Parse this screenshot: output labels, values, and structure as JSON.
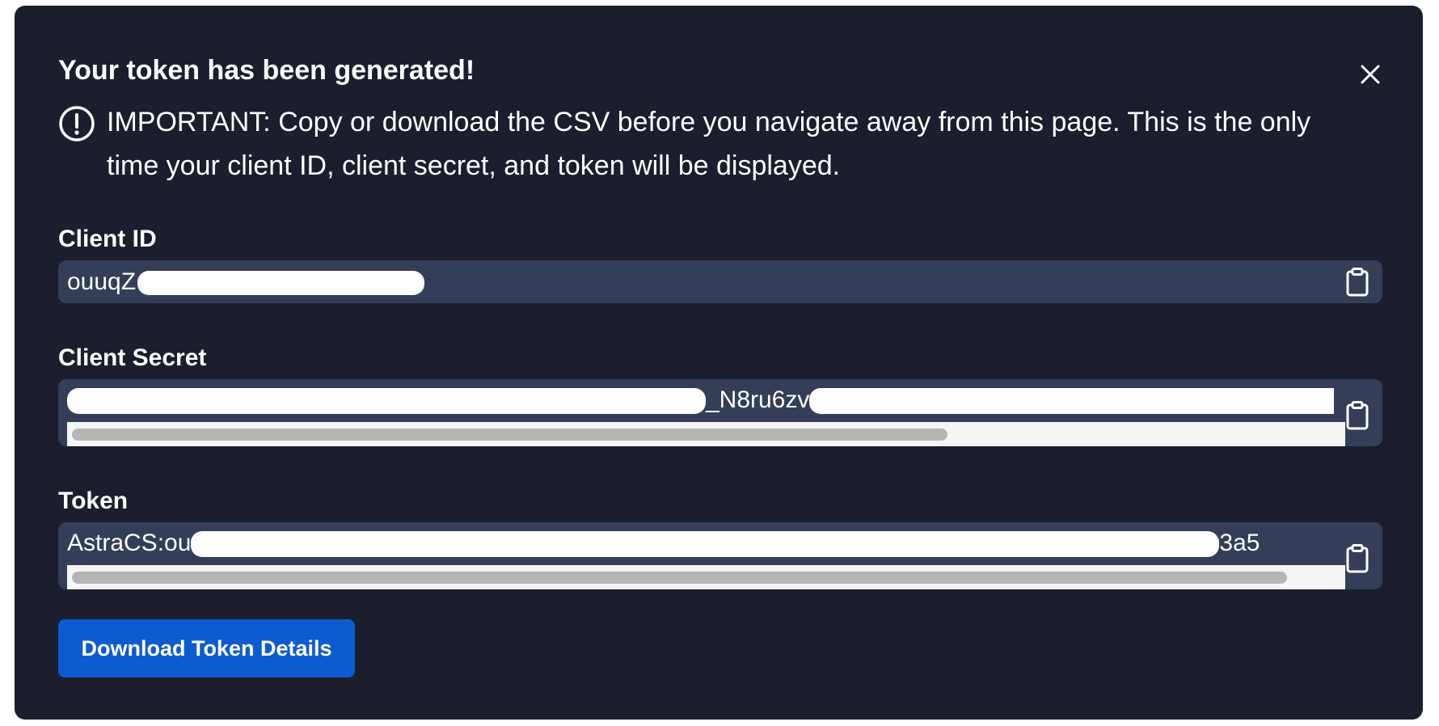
{
  "dialog": {
    "title": "Your token has been generated!",
    "notice": "IMPORTANT: Copy or download the CSV before you navigate away from this page. This is the only time your client ID, client secret, and token will be displayed.",
    "icons": {
      "warning": "exclamation-circle-icon",
      "close": "close-icon",
      "copy": "clipboard-icon"
    }
  },
  "fields": {
    "client_id": {
      "label": "Client ID",
      "value_visible": "ouuqZ"
    },
    "client_secret": {
      "label": "Client Secret",
      "value_visible": "_N8ru6zv",
      "scroll_position": 0.67
    },
    "token": {
      "label": "Token",
      "value_visible_prefix": "AstraCS:ou",
      "value_visible_suffix": "3a5",
      "scroll_position": 0.93
    }
  },
  "actions": {
    "download_label": "Download Token Details"
  },
  "colors": {
    "background": "#1b1e2c",
    "field": "#343e59",
    "button": "#0d5bd0",
    "text": "#ffffff"
  }
}
